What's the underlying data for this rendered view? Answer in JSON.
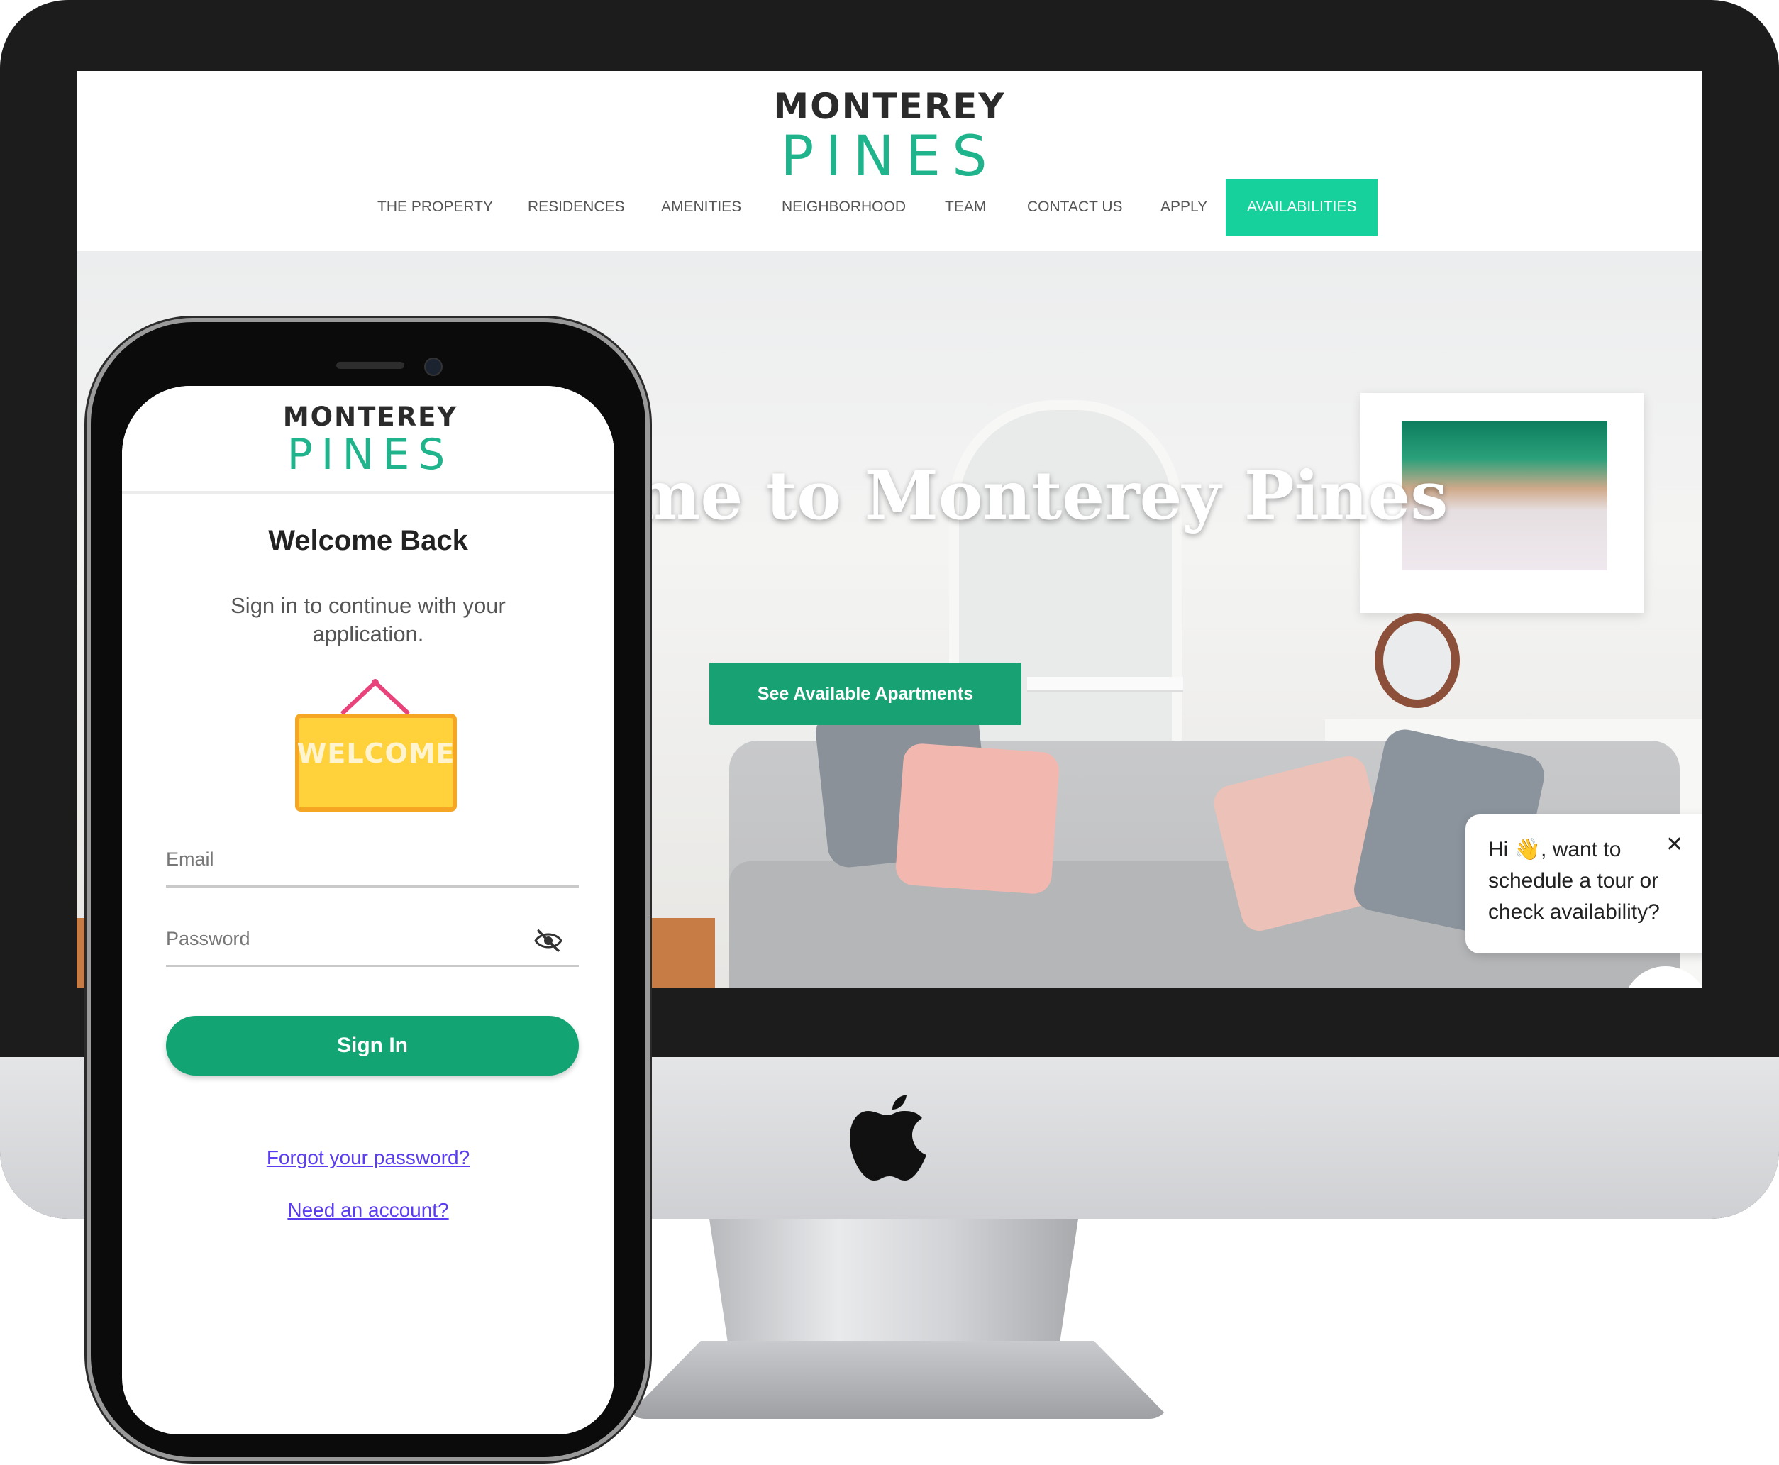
{
  "brand": {
    "name_top": "MONTEREY",
    "name_bottom": "PINES",
    "accent": "#16d19b",
    "cta_green": "#18a273",
    "logo_green": "#1fb48c"
  },
  "site": {
    "nav": [
      {
        "label": "THE PROPERTY"
      },
      {
        "label": "RESIDENCES"
      },
      {
        "label": "AMENITIES"
      },
      {
        "label": "NEIGHBORHOOD"
      },
      {
        "label": "TEAM"
      },
      {
        "label": "CONTACT US"
      },
      {
        "label": "APPLY"
      },
      {
        "label": "AVAILABILITIES",
        "active": true
      }
    ],
    "hero_title": "me to Monterey Pines",
    "hero_cta": "See Available Apartments",
    "chat": {
      "message": "Hi 👋, want to schedule a tour or check availability?",
      "close": "✕"
    }
  },
  "app": {
    "title": "Welcome Back",
    "subtitle": "Sign in to continue with your application.",
    "sign_image_text": "WELCOME",
    "email_label": "Email",
    "password_label": "Password",
    "sign_in": "Sign In",
    "forgot": "Forgot your password?",
    "need_account": "Need an account?"
  },
  "icons": [
    "apple-logo-icon",
    "eye-slash-icon",
    "close-icon",
    "welcome-sign-icon"
  ]
}
